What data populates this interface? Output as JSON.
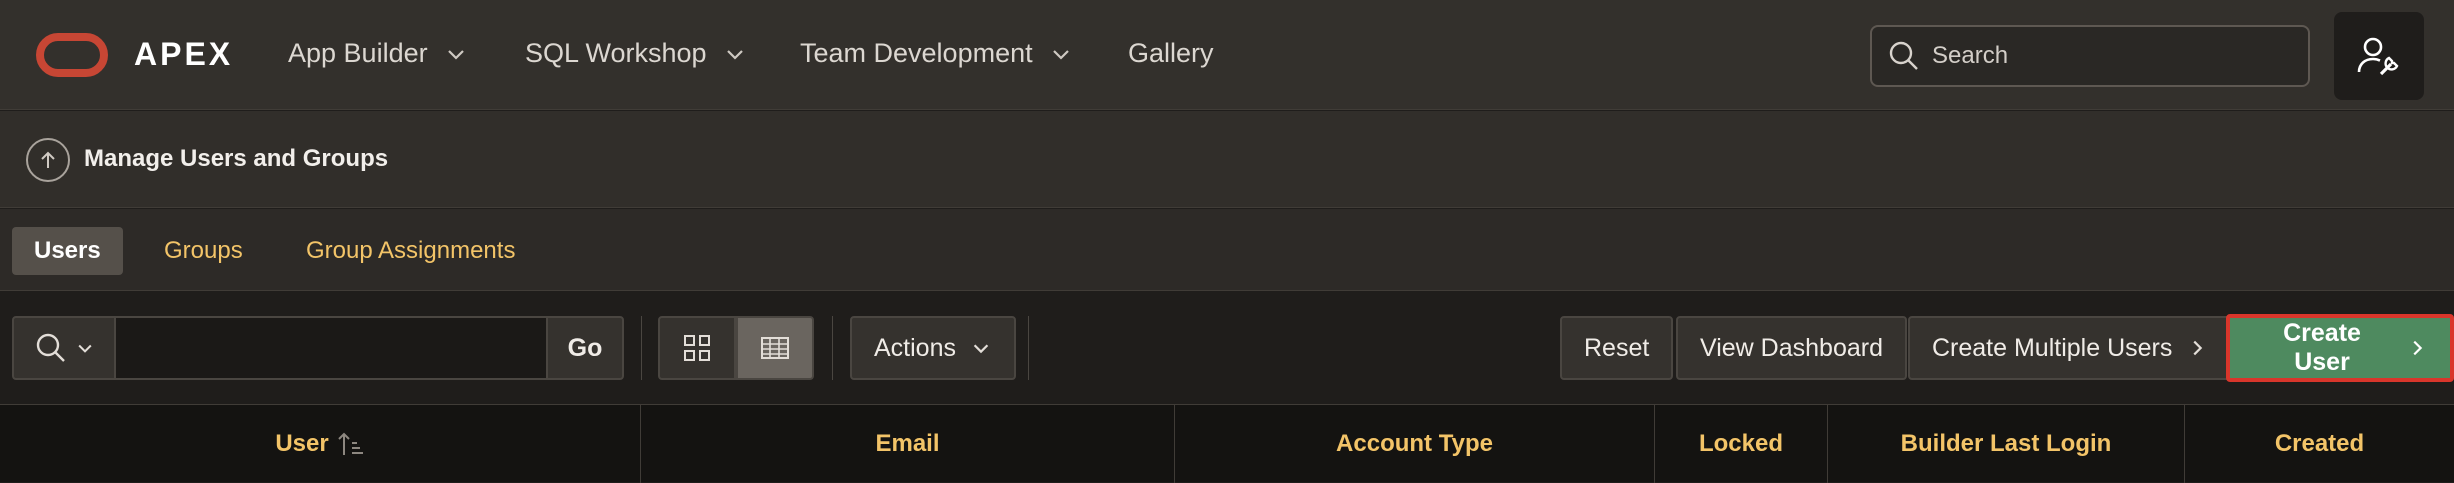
{
  "brand": {
    "name": "APEX",
    "logo_color": "#c74634"
  },
  "nav": [
    {
      "label": "App Builder",
      "has_menu": true
    },
    {
      "label": "SQL Workshop",
      "has_menu": true
    },
    {
      "label": "Team Development",
      "has_menu": true
    },
    {
      "label": "Gallery",
      "has_menu": false
    }
  ],
  "search": {
    "placeholder": "Search",
    "value": ""
  },
  "page": {
    "title": "Manage Users and Groups"
  },
  "tabs": [
    {
      "label": "Users",
      "active": true
    },
    {
      "label": "Groups",
      "active": false
    },
    {
      "label": "Group Assignments",
      "active": false
    }
  ],
  "toolbar": {
    "search_value": "",
    "go_label": "Go",
    "view_modes": [
      "icon-view",
      "report-view"
    ],
    "selected_view": "report-view",
    "actions_label": "Actions",
    "reset_label": "Reset",
    "view_dashboard_label": "View Dashboard",
    "create_multiple_label": "Create Multiple Users",
    "create_user_label": "Create User"
  },
  "report": {
    "columns": [
      "User",
      "Email",
      "Account Type",
      "Locked",
      "Builder Last Login",
      "Created"
    ],
    "sort_column": "User",
    "sort_direction": "ascending"
  },
  "colors": {
    "accent_link": "#f3c468",
    "primary_button": "#4e8a5f",
    "highlight_border": "#d9362b"
  }
}
